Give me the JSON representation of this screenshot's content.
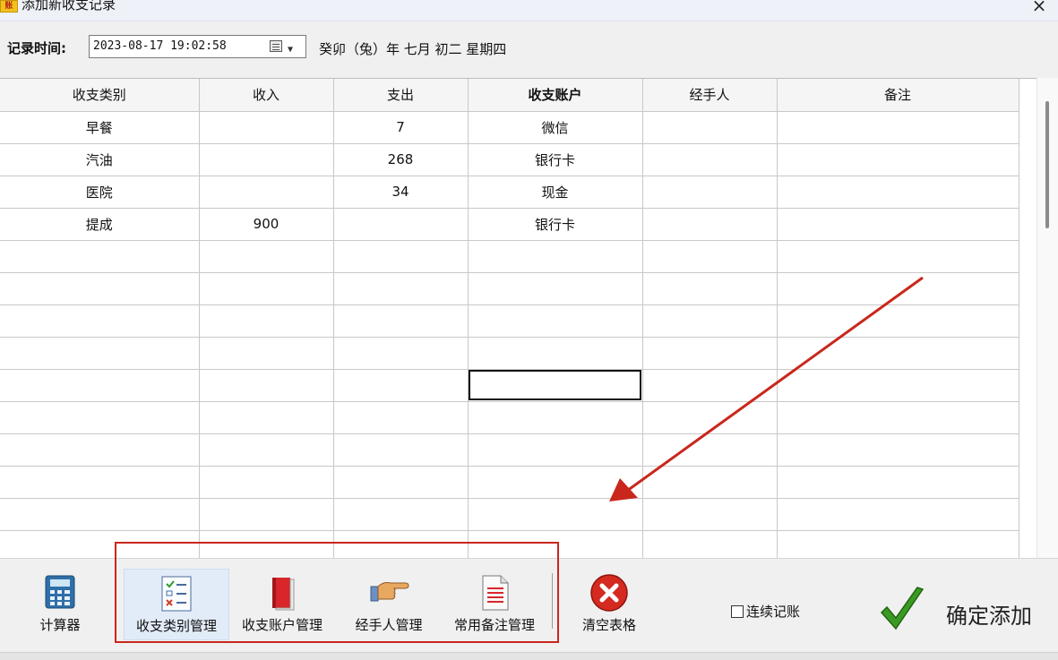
{
  "window": {
    "title": "添加新收支记录",
    "icon_text": "账",
    "close_glyph": "×"
  },
  "date_row": {
    "label": "记录时间:",
    "datetime_value": "2023-08-17 19:02:58",
    "lunar_text": "癸卯（兔）年 七月 初二 星期四"
  },
  "grid": {
    "columns": [
      "收支类别",
      "收入",
      "支出",
      "收支账户",
      "经手人",
      "备注"
    ],
    "rows": [
      [
        "早餐",
        "",
        "7",
        "微信",
        "",
        ""
      ],
      [
        "汽油",
        "",
        "268",
        "银行卡",
        "",
        ""
      ],
      [
        "医院",
        "",
        "34",
        "现金",
        "",
        ""
      ],
      [
        "提成",
        "900",
        "",
        "银行卡",
        "",
        ""
      ],
      [
        "",
        "",
        "",
        "",
        "",
        ""
      ],
      [
        "",
        "",
        "",
        "",
        "",
        ""
      ],
      [
        "",
        "",
        "",
        "",
        "",
        ""
      ],
      [
        "",
        "",
        "",
        "",
        "",
        ""
      ],
      [
        "",
        "",
        "",
        "",
        "",
        ""
      ],
      [
        "",
        "",
        "",
        "",
        "",
        ""
      ],
      [
        "",
        "",
        "",
        "",
        "",
        ""
      ],
      [
        "",
        "",
        "",
        "",
        "",
        ""
      ],
      [
        "",
        "",
        "",
        "",
        "",
        ""
      ],
      [
        "",
        "",
        "",
        "",
        "",
        ""
      ]
    ]
  },
  "toolbar": {
    "calculator": "计算器",
    "category_mgmt": "收支类别管理",
    "account_mgmt": "收支账户管理",
    "handler_mgmt": "经手人管理",
    "remark_mgmt": "常用备注管理",
    "clear_table": "清空表格",
    "continuous_label": "连续记账",
    "confirm_label": "确定添加"
  },
  "colors": {
    "annotation_red": "#c9271c",
    "confirm_green": "#3a9a22",
    "clear_red": "#d42a20"
  }
}
